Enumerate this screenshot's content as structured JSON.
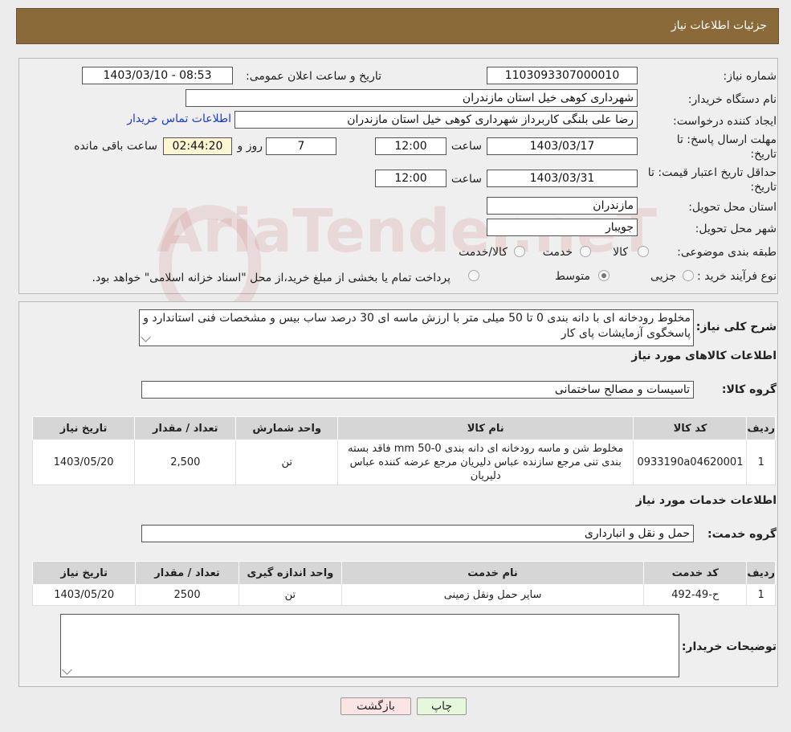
{
  "header": {
    "title": "جزئیات اطلاعات نیاز"
  },
  "form": {
    "need_no_label": "شماره نیاز:",
    "need_no": "1103093307000010",
    "announce_label": "تاریخ و ساعت اعلان عمومی:",
    "announce_value": "1403/03/10 - 08:53",
    "buyer_org_label": "نام دستگاه خریدار:",
    "buyer_org": "شهرداری کوهی خیل استان مازندران",
    "requester_label": "ایجاد کننده درخواست:",
    "requester": "رضا علی  بلنگی  کاربرداز شهرداری کوهی خیل استان مازندران",
    "contact_link": "اطلاعات تماس خریدار",
    "deadline_label_1": "مهلت ارسال پاسخ: تا",
    "deadline_label_2": "تاریخ:",
    "deadline_date": "1403/03/17",
    "time_label": "ساعت",
    "deadline_time": "12:00",
    "days_value": "7",
    "days_label": "روز و",
    "remaining_time": "02:44:20",
    "remaining_label": "ساعت باقی مانده",
    "validity_label_1": "حداقل تاریخ اعتبار قیمت: تا",
    "validity_label_2": "تاریخ:",
    "validity_date": "1403/03/31",
    "validity_time": "12:00",
    "province_label": "استان محل تحویل:",
    "province": "مازندران",
    "city_label": "شهر محل تحویل:",
    "city": "جویبار",
    "category_label": "طبقه بندی موضوعی:",
    "category_options": [
      "کالا",
      "خدمت",
      "کالا/خدمت"
    ],
    "process_label": "نوع فرآیند خرید :",
    "process_options": [
      "جزیی",
      "متوسط"
    ],
    "process_note": "پرداخت تمام یا بخشی از مبلغ خرید،از محل \"اسناد خزانه اسلامی\" خواهد بود."
  },
  "description": {
    "label": "شرح کلی نیاز:",
    "text": "مخلوط رودخانه ای با دانه بندی 0 تا 50 میلی متر با ارزش ماسه ای 30 درصد ساب بیس و مشخصات فنی استاندارد و پاسخگوی آزمایشات پای کار"
  },
  "goods": {
    "section_title": "اطلاعات کالاهای مورد نیاز",
    "group_label": "گروه کالا:",
    "group_value": "تاسیسات و مصالح ساختمانی",
    "columns": [
      "ردیف",
      "کد کالا",
      "نام کالا",
      "واحد شمارش",
      "تعداد / مقدار",
      "تاریخ نیاز"
    ],
    "rows": [
      {
        "row": "1",
        "code": "0933190a04620001",
        "name": "مخلوط شن و ماسه رودخانه ای دانه بندی mm 50-0 فاقد بسته بندی تنی مرجع سازنده عباس دلیریان مرجع عرضه کننده عباس دلیریان",
        "unit": "تن",
        "qty": "2,500",
        "date": "1403/05/20"
      }
    ]
  },
  "services": {
    "section_title": "اطلاعات خدمات مورد نیاز",
    "group_label": "گروه خدمت:",
    "group_value": "حمل و نقل و انبارداری",
    "columns": [
      "ردیف",
      "کد خدمت",
      "نام خدمت",
      "واحد اندازه گیری",
      "تعداد / مقدار",
      "تاریخ نیاز"
    ],
    "rows": [
      {
        "row": "1",
        "code": "ح-49-492",
        "name": "سایر حمل ونقل زمینی",
        "unit": "تن",
        "qty": "2500",
        "date": "1403/05/20"
      }
    ]
  },
  "buyer_notes": {
    "label": "توضیحات خریدار:",
    "value": ""
  },
  "buttons": {
    "print": "چاپ",
    "back": "بازگشت"
  },
  "watermark": "AriaTender.neT"
}
